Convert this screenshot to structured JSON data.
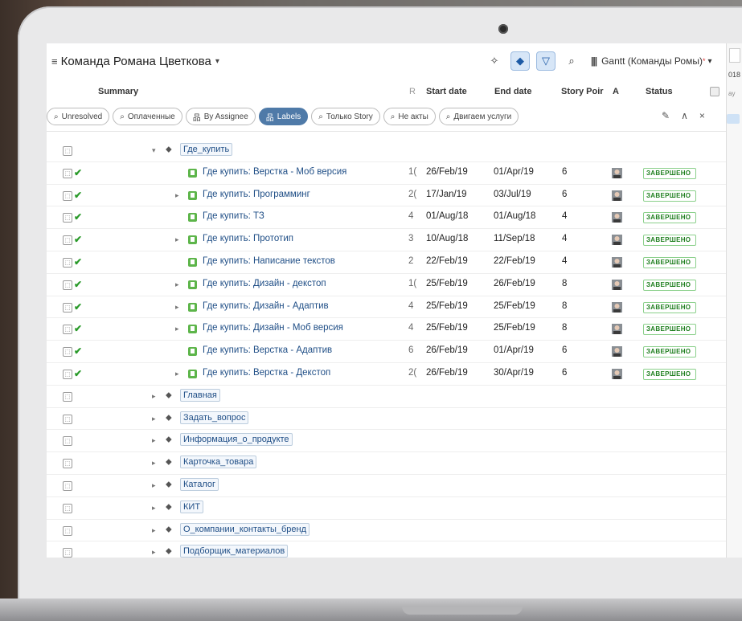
{
  "board": {
    "title": "Команда Романа Цветкова",
    "caret": "▾",
    "menu_icon": "≡"
  },
  "toolbar": {
    "pin_icon": "✧",
    "layers_icon": "◆",
    "filter_icon": "▽",
    "search_icon": "⌕",
    "gantt_bars": "|||",
    "gantt_label": "Gantt (Команды Ромы)",
    "gantt_star": "*",
    "gantt_caret": "▾"
  },
  "right_panel": {
    "year": "018",
    "ay": "ay"
  },
  "columns": {
    "summary": "Summary",
    "r": "R",
    "start": "Start date",
    "end": "End date",
    "story_points": "Story Poir",
    "assignee": "A",
    "status": "Status"
  },
  "chips": [
    {
      "label": "Unresolved",
      "icon": "⌕"
    },
    {
      "label": "Оплаченные",
      "icon": "⌕"
    },
    {
      "label": "By Assignee",
      "icon": "品"
    },
    {
      "label": "Labels",
      "icon": "品"
    },
    {
      "label": "Только Story",
      "icon": "⌕"
    },
    {
      "label": "Не акты",
      "icon": "⌕"
    },
    {
      "label": "Двигаем услуги",
      "icon": "⌕"
    }
  ],
  "chip_actions": {
    "edit": "✎",
    "collapse": "∧",
    "close": "×"
  },
  "group": {
    "label": "Где_купить",
    "toggle": "▾",
    "tag_icon": "⬥"
  },
  "issues": [
    {
      "name": "Где купить: Верстка - Моб версия",
      "r": "1(",
      "start": "26/Feb/19",
      "end": "01/Apr/19",
      "sp": "6",
      "status": "ЗАВЕРШЕНО",
      "has_children": false
    },
    {
      "name": "Где купить: Программинг",
      "r": "2(",
      "start": "17/Jan/19",
      "end": "03/Jul/19",
      "sp": "6",
      "status": "ЗАВЕРШЕНО",
      "has_children": true
    },
    {
      "name": "Где купить: ТЗ",
      "r": "4",
      "start": "01/Aug/18",
      "end": "01/Aug/18",
      "sp": "4",
      "status": "ЗАВЕРШЕНО",
      "has_children": false
    },
    {
      "name": "Где купить: Прототип",
      "r": "3",
      "start": "10/Aug/18",
      "end": "11/Sep/18",
      "sp": "4",
      "status": "ЗАВЕРШЕНО",
      "has_children": true
    },
    {
      "name": "Где купить: Написание текстов",
      "r": "2",
      "start": "22/Feb/19",
      "end": "22/Feb/19",
      "sp": "4",
      "status": "ЗАВЕРШЕНО",
      "has_children": false
    },
    {
      "name": "Где купить: Дизайн - декстоп",
      "r": "1(",
      "start": "25/Feb/19",
      "end": "26/Feb/19",
      "sp": "8",
      "status": "ЗАВЕРШЕНО",
      "has_children": true
    },
    {
      "name": "Где купить: Дизайн - Адаптив",
      "r": "4",
      "start": "25/Feb/19",
      "end": "25/Feb/19",
      "sp": "8",
      "status": "ЗАВЕРШЕНО",
      "has_children": true
    },
    {
      "name": "Где купить: Дизайн - Моб версия",
      "r": "4",
      "start": "25/Feb/19",
      "end": "25/Feb/19",
      "sp": "8",
      "status": "ЗАВЕРШЕНО",
      "has_children": true
    },
    {
      "name": "Где купить: Верстка - Адаптив",
      "r": "6",
      "start": "26/Feb/19",
      "end": "01/Apr/19",
      "sp": "6",
      "status": "ЗАВЕРШЕНО",
      "has_children": false
    },
    {
      "name": "Где купить: Верстка - Декстоп",
      "r": "2(",
      "start": "26/Feb/19",
      "end": "30/Apr/19",
      "sp": "6",
      "status": "ЗАВЕРШЕНО",
      "has_children": true
    }
  ],
  "labels": [
    "Главная",
    "Задать_вопрос",
    "Информация_о_продукте",
    "Карточка_товара",
    "Каталог",
    "КИТ",
    "О_компании_контакты_бренд",
    "Подборщик_материалов"
  ],
  "colors": {
    "accent": "#4f7aa8",
    "status_green": "#1f7f1f",
    "link": "#1f4e86"
  }
}
